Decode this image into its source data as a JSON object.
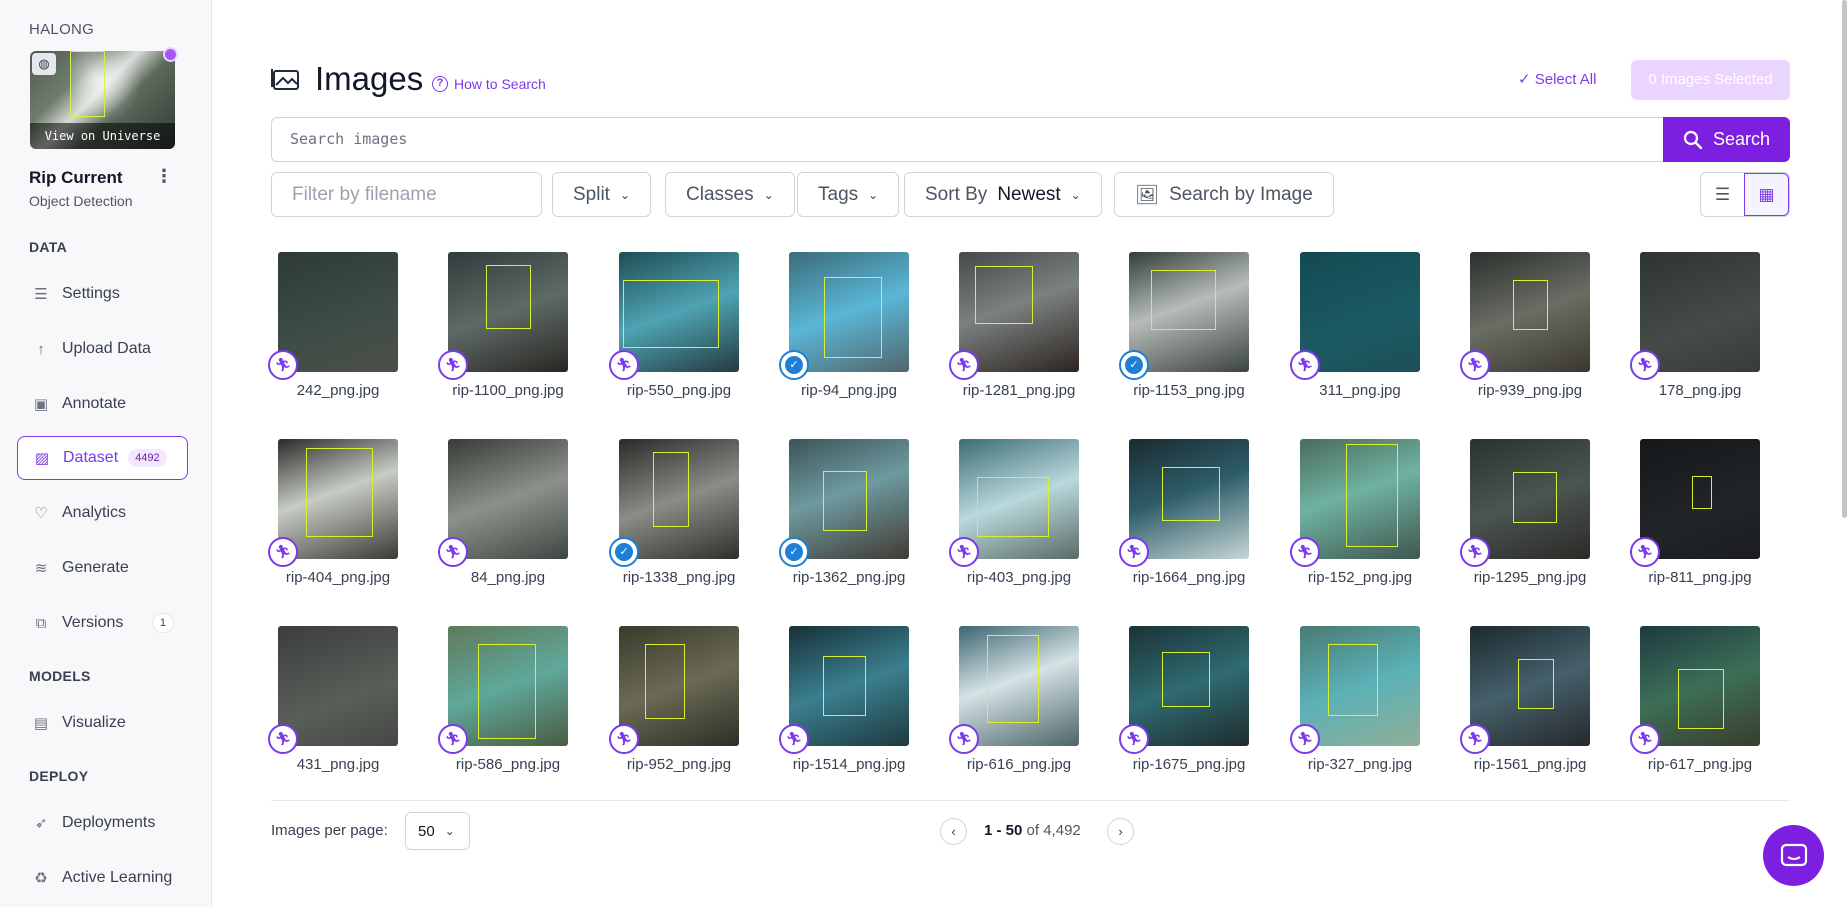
{
  "sidebar": {
    "workspace": "HALONG",
    "thumbnail_caption": "View on Universe",
    "project_name": "Rip Current",
    "project_type": "Object Detection",
    "sections": {
      "data": "DATA",
      "models": "MODELS",
      "deploy": "DEPLOY"
    },
    "items": [
      {
        "label": "Settings",
        "icon": "settings-list-icon"
      },
      {
        "label": "Upload Data",
        "icon": "upload-arrow-icon"
      },
      {
        "label": "Annotate",
        "icon": "annotate-icon"
      },
      {
        "label": "Dataset",
        "icon": "dataset-image-icon",
        "badge": "4492"
      },
      {
        "label": "Analytics",
        "icon": "analytics-icon"
      },
      {
        "label": "Generate",
        "icon": "generate-icon"
      },
      {
        "label": "Versions",
        "icon": "versions-icon",
        "badge": "1"
      },
      {
        "label": "Visualize",
        "icon": "visualize-icon"
      },
      {
        "label": "Deployments",
        "icon": "rocket-icon"
      },
      {
        "label": "Active Learning",
        "icon": "active-learning-icon"
      }
    ]
  },
  "header": {
    "title": "Images",
    "how_to_search": "How to Search",
    "select_all": "Select All",
    "selected": "0 Images Selected"
  },
  "search": {
    "placeholder": "Search images",
    "button": "Search"
  },
  "filters": {
    "filename_placeholder": "Filter by filename",
    "split": "Split",
    "classes": "Classes",
    "tags": "Tags",
    "sort_label": "Sort By",
    "sort_value": "Newest",
    "search_by_image": "Search by Image"
  },
  "images": [
    {
      "name": "242_png.jpg",
      "status": "annotate"
    },
    {
      "name": "rip-1100_png.jpg",
      "status": "annotate"
    },
    {
      "name": "rip-550_png.jpg",
      "status": "annotate"
    },
    {
      "name": "rip-94_png.jpg",
      "status": "approved"
    },
    {
      "name": "rip-1281_png.jpg",
      "status": "annotate"
    },
    {
      "name": "rip-1153_png.jpg",
      "status": "approved"
    },
    {
      "name": "311_png.jpg",
      "status": "annotate"
    },
    {
      "name": "rip-939_png.jpg",
      "status": "annotate"
    },
    {
      "name": "178_png.jpg",
      "status": "annotate"
    },
    {
      "name": "rip-404_png.jpg",
      "status": "annotate"
    },
    {
      "name": "84_png.jpg",
      "status": "annotate"
    },
    {
      "name": "rip-1338_png.jpg",
      "status": "approved"
    },
    {
      "name": "rip-1362_png.jpg",
      "status": "approved"
    },
    {
      "name": "rip-403_png.jpg",
      "status": "annotate"
    },
    {
      "name": "rip-1664_png.jpg",
      "status": "annotate"
    },
    {
      "name": "rip-152_png.jpg",
      "status": "annotate"
    },
    {
      "name": "rip-1295_png.jpg",
      "status": "annotate"
    },
    {
      "name": "rip-811_png.jpg",
      "status": "annotate"
    },
    {
      "name": "431_png.jpg",
      "status": "annotate"
    },
    {
      "name": "rip-586_png.jpg",
      "status": "annotate"
    },
    {
      "name": "rip-952_png.jpg",
      "status": "annotate"
    },
    {
      "name": "rip-1514_png.jpg",
      "status": "annotate"
    },
    {
      "name": "rip-616_png.jpg",
      "status": "annotate"
    },
    {
      "name": "rip-1675_png.jpg",
      "status": "annotate"
    },
    {
      "name": "rip-327_png.jpg",
      "status": "annotate"
    },
    {
      "name": "rip-1561_png.jpg",
      "status": "annotate"
    },
    {
      "name": "rip-617_png.jpg",
      "status": "annotate"
    }
  ],
  "pagination": {
    "per_page_label": "Images per page:",
    "per_page": "50",
    "range": "1 - 50",
    "of": "of",
    "total": "4,492"
  },
  "colors": {
    "accent": "#7c1fe0",
    "bbox": "#d9f02f",
    "approved": "#1d7fd6"
  }
}
